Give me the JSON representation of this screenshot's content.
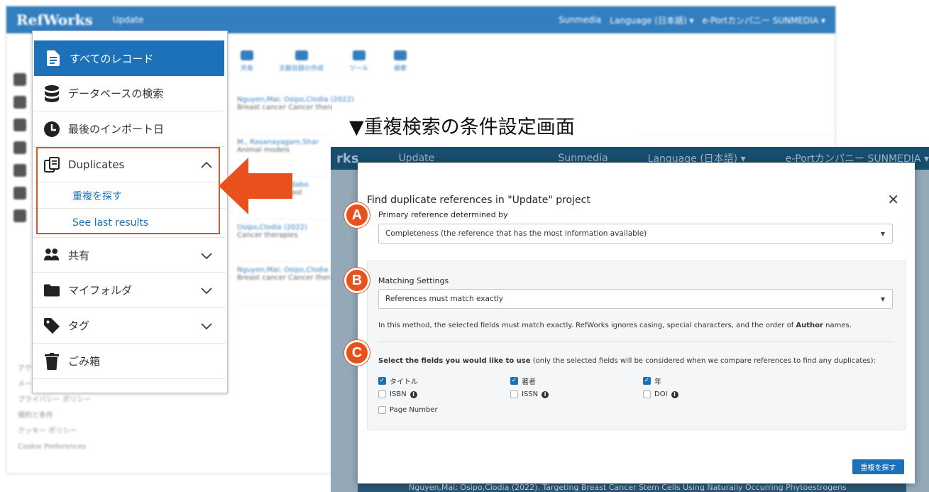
{
  "app": {
    "logo": "RefWorks",
    "project": "Update",
    "user": "Sunmedia",
    "language": "Language (日本語) ▾",
    "org": "e-Portカンパニー SUNMEDIA ▾",
    "toolbar": [
      "共有",
      "文献目録の作成",
      "ツール",
      "検索"
    ],
    "footer_links": [
      "アクセシビリティ",
      "メール",
      "プライバシー ポリシー",
      "規約と条件",
      "クッキー ポリシー",
      "Cookie Preferences"
    ],
    "rows": [
      {
        "title": "Nguyen,Mai; Osipo,Clodia (2022)",
        "tags": "Breast cancer  Cancer therapies"
      },
      {
        "title": "M., Rasanayagam,Shar",
        "tags": "Animal models"
      },
      {
        "title": "Ozsky,Jack; Kerdabo",
        "tags": "Biomarkers  Breast"
      },
      {
        "title": "Osipo,Clodia (2022)",
        "tags": "Cancer therapies"
      },
      {
        "title": "Nguyen,Mai; Osipo,Clodia (2022)",
        "tags": "Breast cancer  Cancer therapies"
      }
    ]
  },
  "menu": {
    "all_records": "すべてのレコード",
    "db_search": "データベースの検索",
    "last_import": "最後のインポート日",
    "duplicates": "Duplicates",
    "find_dups": "重複を探す",
    "see_last": "See last results",
    "shared": "共有",
    "my_folders": "マイフォルダ",
    "tags": "タグ",
    "trash": "ごみ箱"
  },
  "caption": "▼重複検索の条件設定画面",
  "bg_window": {
    "logo": "rks",
    "project": "Update",
    "user": "Sunmedia",
    "language": "Language (日本語) ▾",
    "org": "e-Portカンパニー SUNMEDIA ▾",
    "bottom_text": "Nguyen,Mai; Osipo,Clodia (2022). Targeting Breast Cancer Stem Cells Using Naturally Occurring Phytoestrogens"
  },
  "dialog": {
    "title": "Find duplicate references in \"Update\" project",
    "primary_label": "Primary reference determined by",
    "primary_value": "Completeness (the reference that has the most information available)",
    "matching_label": "Matching Settings",
    "matching_value": "References must match exactly",
    "desc_pre": "In this method, the selected fields must match exactly. RefWorks ignores casing, special characters, and the order of ",
    "desc_bold": "Author",
    "desc_post": " names.",
    "fields_bold": "Select the fields you would like to use",
    "fields_rest": " (only the selected fields will be considered when we compare references to find any duplicates):",
    "fields": [
      {
        "label": "タイトル",
        "checked": true
      },
      {
        "label": "著者",
        "checked": true
      },
      {
        "label": "年",
        "checked": true
      },
      {
        "label": "ISBN",
        "checked": false,
        "info": true
      },
      {
        "label": "ISSN",
        "checked": false,
        "info": true
      },
      {
        "label": "DOI",
        "checked": false,
        "info": true
      },
      {
        "label": "Page Number",
        "checked": false
      }
    ],
    "find_button": "重複を探す"
  },
  "badges": [
    "A",
    "B",
    "C"
  ],
  "colors": {
    "accent": "#1d71b8",
    "highlight": "#e8511b"
  }
}
